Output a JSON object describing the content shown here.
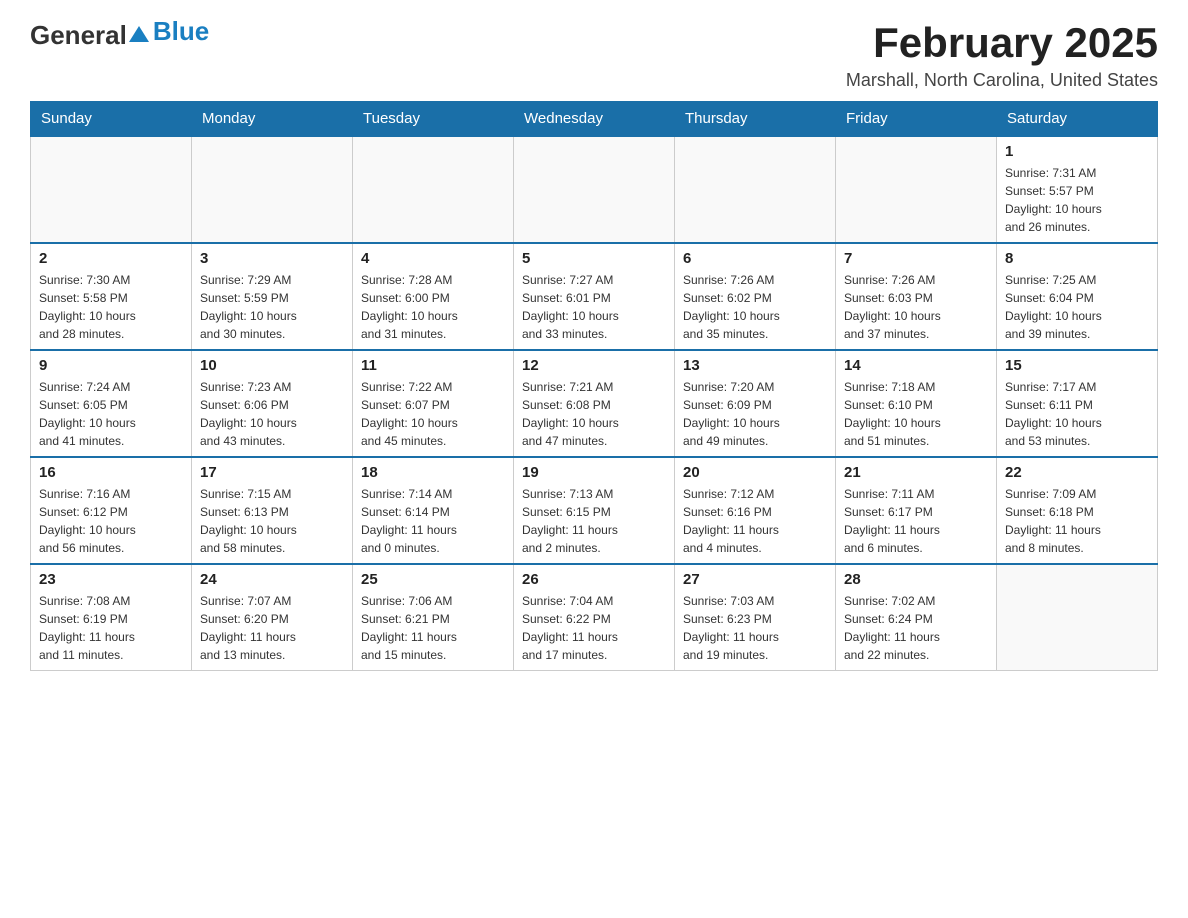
{
  "header": {
    "logo_general": "General",
    "logo_blue": "Blue",
    "month_title": "February 2025",
    "location": "Marshall, North Carolina, United States"
  },
  "days_of_week": [
    "Sunday",
    "Monday",
    "Tuesday",
    "Wednesday",
    "Thursday",
    "Friday",
    "Saturday"
  ],
  "weeks": [
    {
      "days": [
        {
          "num": "",
          "info": ""
        },
        {
          "num": "",
          "info": ""
        },
        {
          "num": "",
          "info": ""
        },
        {
          "num": "",
          "info": ""
        },
        {
          "num": "",
          "info": ""
        },
        {
          "num": "",
          "info": ""
        },
        {
          "num": "1",
          "info": "Sunrise: 7:31 AM\nSunset: 5:57 PM\nDaylight: 10 hours\nand 26 minutes."
        }
      ]
    },
    {
      "days": [
        {
          "num": "2",
          "info": "Sunrise: 7:30 AM\nSunset: 5:58 PM\nDaylight: 10 hours\nand 28 minutes."
        },
        {
          "num": "3",
          "info": "Sunrise: 7:29 AM\nSunset: 5:59 PM\nDaylight: 10 hours\nand 30 minutes."
        },
        {
          "num": "4",
          "info": "Sunrise: 7:28 AM\nSunset: 6:00 PM\nDaylight: 10 hours\nand 31 minutes."
        },
        {
          "num": "5",
          "info": "Sunrise: 7:27 AM\nSunset: 6:01 PM\nDaylight: 10 hours\nand 33 minutes."
        },
        {
          "num": "6",
          "info": "Sunrise: 7:26 AM\nSunset: 6:02 PM\nDaylight: 10 hours\nand 35 minutes."
        },
        {
          "num": "7",
          "info": "Sunrise: 7:26 AM\nSunset: 6:03 PM\nDaylight: 10 hours\nand 37 minutes."
        },
        {
          "num": "8",
          "info": "Sunrise: 7:25 AM\nSunset: 6:04 PM\nDaylight: 10 hours\nand 39 minutes."
        }
      ]
    },
    {
      "days": [
        {
          "num": "9",
          "info": "Sunrise: 7:24 AM\nSunset: 6:05 PM\nDaylight: 10 hours\nand 41 minutes."
        },
        {
          "num": "10",
          "info": "Sunrise: 7:23 AM\nSunset: 6:06 PM\nDaylight: 10 hours\nand 43 minutes."
        },
        {
          "num": "11",
          "info": "Sunrise: 7:22 AM\nSunset: 6:07 PM\nDaylight: 10 hours\nand 45 minutes."
        },
        {
          "num": "12",
          "info": "Sunrise: 7:21 AM\nSunset: 6:08 PM\nDaylight: 10 hours\nand 47 minutes."
        },
        {
          "num": "13",
          "info": "Sunrise: 7:20 AM\nSunset: 6:09 PM\nDaylight: 10 hours\nand 49 minutes."
        },
        {
          "num": "14",
          "info": "Sunrise: 7:18 AM\nSunset: 6:10 PM\nDaylight: 10 hours\nand 51 minutes."
        },
        {
          "num": "15",
          "info": "Sunrise: 7:17 AM\nSunset: 6:11 PM\nDaylight: 10 hours\nand 53 minutes."
        }
      ]
    },
    {
      "days": [
        {
          "num": "16",
          "info": "Sunrise: 7:16 AM\nSunset: 6:12 PM\nDaylight: 10 hours\nand 56 minutes."
        },
        {
          "num": "17",
          "info": "Sunrise: 7:15 AM\nSunset: 6:13 PM\nDaylight: 10 hours\nand 58 minutes."
        },
        {
          "num": "18",
          "info": "Sunrise: 7:14 AM\nSunset: 6:14 PM\nDaylight: 11 hours\nand 0 minutes."
        },
        {
          "num": "19",
          "info": "Sunrise: 7:13 AM\nSunset: 6:15 PM\nDaylight: 11 hours\nand 2 minutes."
        },
        {
          "num": "20",
          "info": "Sunrise: 7:12 AM\nSunset: 6:16 PM\nDaylight: 11 hours\nand 4 minutes."
        },
        {
          "num": "21",
          "info": "Sunrise: 7:11 AM\nSunset: 6:17 PM\nDaylight: 11 hours\nand 6 minutes."
        },
        {
          "num": "22",
          "info": "Sunrise: 7:09 AM\nSunset: 6:18 PM\nDaylight: 11 hours\nand 8 minutes."
        }
      ]
    },
    {
      "days": [
        {
          "num": "23",
          "info": "Sunrise: 7:08 AM\nSunset: 6:19 PM\nDaylight: 11 hours\nand 11 minutes."
        },
        {
          "num": "24",
          "info": "Sunrise: 7:07 AM\nSunset: 6:20 PM\nDaylight: 11 hours\nand 13 minutes."
        },
        {
          "num": "25",
          "info": "Sunrise: 7:06 AM\nSunset: 6:21 PM\nDaylight: 11 hours\nand 15 minutes."
        },
        {
          "num": "26",
          "info": "Sunrise: 7:04 AM\nSunset: 6:22 PM\nDaylight: 11 hours\nand 17 minutes."
        },
        {
          "num": "27",
          "info": "Sunrise: 7:03 AM\nSunset: 6:23 PM\nDaylight: 11 hours\nand 19 minutes."
        },
        {
          "num": "28",
          "info": "Sunrise: 7:02 AM\nSunset: 6:24 PM\nDaylight: 11 hours\nand 22 minutes."
        },
        {
          "num": "",
          "info": ""
        }
      ]
    }
  ]
}
